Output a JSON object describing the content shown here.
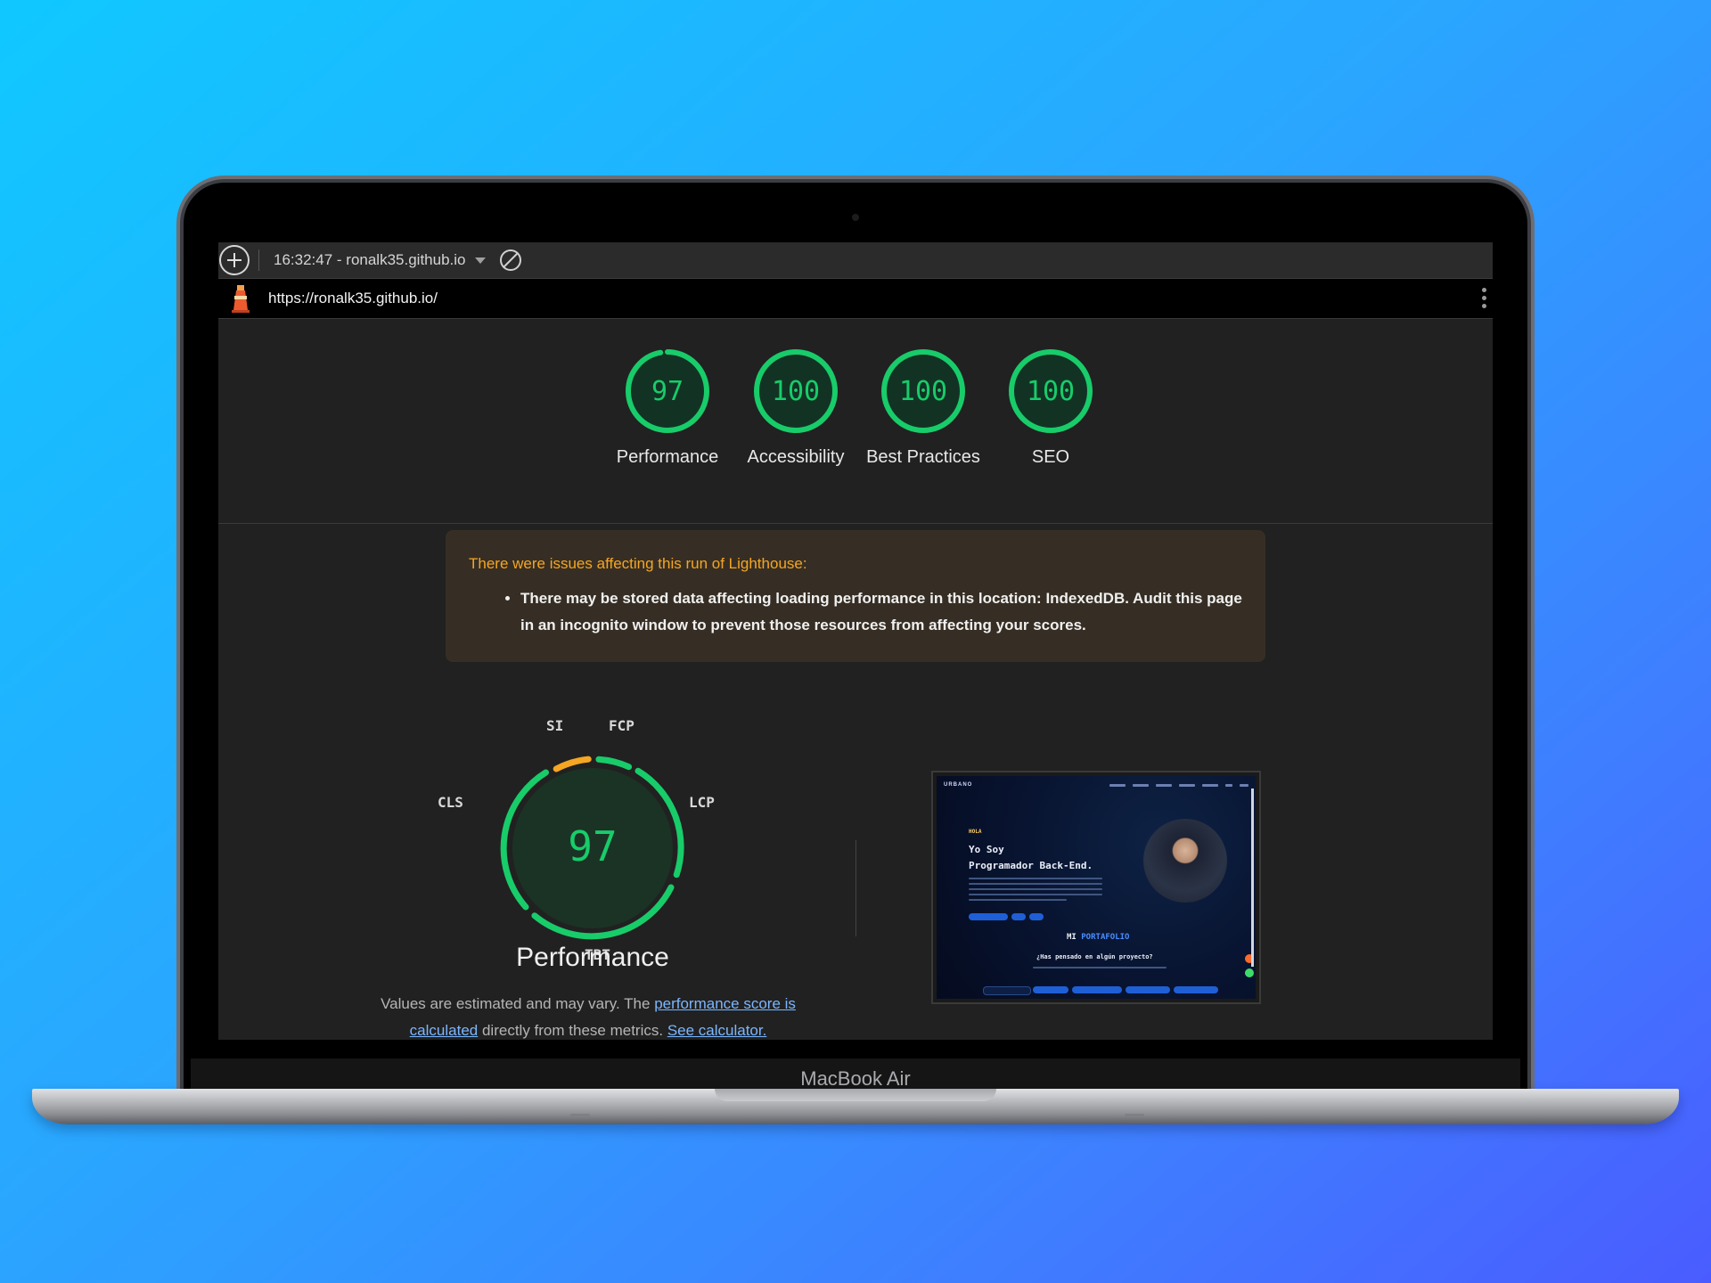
{
  "laptop": {
    "model_label": "MacBook Air"
  },
  "devtools": {
    "run_label": "16:32:47 - ronalk35.github.io",
    "url": "https://ronalk35.github.io/"
  },
  "categories": [
    {
      "name": "Performance",
      "score": 97
    },
    {
      "name": "Accessibility",
      "score": 100
    },
    {
      "name": "Best Practices",
      "score": 100
    },
    {
      "name": "SEO",
      "score": 100
    }
  ],
  "colors": {
    "pass": "#18cc6a",
    "average": "#f5a623",
    "warning_text": "#f5a623"
  },
  "warning": {
    "title": "There were issues affecting this run of Lighthouse:",
    "items": [
      "There may be stored data affecting loading performance in this location: IndexedDB. Audit this page in an incognito window to prevent those resources from affecting your scores."
    ]
  },
  "performance": {
    "score": 97,
    "title": "Performance",
    "metrics": [
      "SI",
      "FCP",
      "LCP",
      "TBT",
      "CLS"
    ],
    "note_prefix": "Values are estimated and may vary. The",
    "note_link1": "performance score is calculated",
    "note_mid": "directly from these metrics.",
    "note_link2": "See calculator."
  },
  "thumbnail": {
    "logo": "URBANO",
    "greeting": "HOLA",
    "line1": "Yo Soy",
    "line2": "Programador Back-End.",
    "section_prefix": "MI",
    "section_highlight": "PORTAFOLIO",
    "question": "¿Has pensado en algún proyecto?"
  }
}
